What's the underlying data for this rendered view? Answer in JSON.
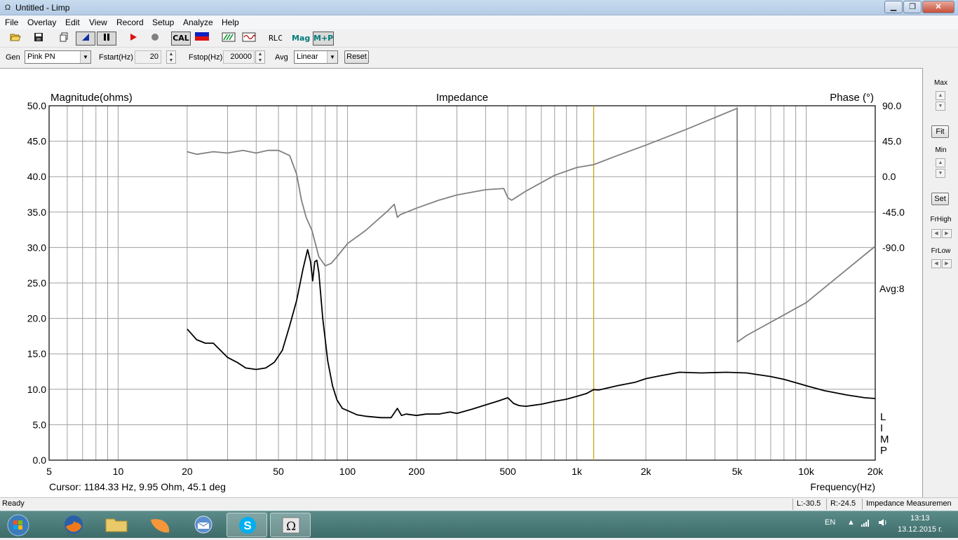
{
  "window": {
    "title": "Untitled - Limp",
    "app_icon": "Ω"
  },
  "menu": [
    "File",
    "Overlay",
    "Edit",
    "View",
    "Record",
    "Setup",
    "Analyze",
    "Help"
  ],
  "toolbar": {
    "cal_label": "CAL",
    "rlc_label": "RLC",
    "mag_label": "Mag",
    "mp_label": "M+P"
  },
  "params": {
    "gen_label": "Gen",
    "gen_value": "Pink PN",
    "fstart_label": "Fstart(Hz)",
    "fstart_value": "20",
    "fstop_label": "Fstop(Hz)",
    "fstop_value": "20000",
    "avg_label": "Avg",
    "avg_value": "Linear",
    "reset_label": "Reset"
  },
  "chart_data": {
    "type": "line",
    "title": "Impedance",
    "ylabel": "Magnitude(ohms)",
    "y2label": "Phase (°)",
    "xlabel": "Frequency(Hz)",
    "xscale": "log",
    "xlim": [
      5,
      20000
    ],
    "ylim": [
      0,
      50
    ],
    "y2lim": [
      -180,
      90
    ],
    "x_ticks": [
      5,
      10,
      20,
      50,
      100,
      200,
      500,
      1000,
      2000,
      5000,
      10000,
      20000
    ],
    "x_tick_labels": [
      "5",
      "10",
      "20",
      "50",
      "100",
      "200",
      "500",
      "1k",
      "2k",
      "5k",
      "10k",
      "20k"
    ],
    "y_tick_labels": [
      "50.0",
      "45.0",
      "40.0",
      "35.0",
      "30.0",
      "25.0",
      "20.0",
      "15.0",
      "10.0",
      "5.0",
      "0.0"
    ],
    "y2_tick_labels": [
      "90.0",
      "45.0",
      "0.0",
      "-45.0",
      "-90.0"
    ],
    "avg_annotation": "Avg:8",
    "side_letters": [
      "L",
      "I",
      "M",
      "P"
    ],
    "cursor_x": 1184.33,
    "cursor_readout": "Cursor: 1184.33 Hz, 9.95 Ohm, 45.1 deg",
    "colors": {
      "magnitude": "#000000",
      "phase": "#808080",
      "cursor": "#c8a000",
      "grid": "#a0a0a0"
    },
    "series": [
      {
        "name": "Magnitude",
        "axis": "left",
        "x": [
          20,
          22,
          24,
          26,
          30,
          33,
          36,
          40,
          44,
          48,
          52,
          56,
          60,
          64,
          67,
          69,
          70.5,
          72,
          73.5,
          75,
          78,
          82,
          86,
          90,
          95,
          100,
          110,
          120,
          140,
          155,
          165,
          172,
          180,
          200,
          220,
          250,
          280,
          300,
          350,
          400,
          450,
          500,
          530,
          560,
          600,
          700,
          800,
          900,
          1000,
          1100,
          1184,
          1250,
          1500,
          1800,
          2000,
          2300,
          2800,
          3500,
          4500,
          5500,
          7000,
          8000,
          10000,
          12000,
          15000,
          18000,
          20000
        ],
        "y": [
          18.5,
          17.0,
          16.5,
          16.5,
          14.5,
          13.8,
          13.0,
          12.8,
          13.0,
          13.8,
          15.5,
          19.0,
          22.5,
          27.0,
          29.7,
          28.0,
          25.3,
          28.0,
          28.2,
          26.5,
          20.0,
          14.0,
          10.5,
          8.5,
          7.3,
          7.0,
          6.4,
          6.2,
          6.0,
          6.0,
          7.3,
          6.3,
          6.5,
          6.3,
          6.5,
          6.5,
          6.8,
          6.6,
          7.2,
          7.8,
          8.3,
          8.8,
          8.0,
          7.7,
          7.6,
          7.9,
          8.3,
          8.6,
          9.0,
          9.4,
          9.95,
          9.9,
          10.5,
          11.0,
          11.5,
          11.9,
          12.4,
          12.3,
          12.4,
          12.3,
          11.8,
          11.4,
          10.5,
          9.8,
          9.2,
          8.8,
          8.7
        ]
      },
      {
        "name": "Phase",
        "axis": "right",
        "x": [
          20,
          22,
          26,
          30,
          35,
          40,
          45,
          50,
          56,
          60,
          63,
          66,
          70,
          75,
          80,
          85,
          90,
          100,
          120,
          150,
          160,
          165,
          170,
          200,
          250,
          300,
          400,
          480,
          500,
          520,
          600,
          800,
          1000,
          1184,
          1500,
          2000,
          3000,
          5000,
          5010,
          5500,
          10000,
          20000
        ],
        "y": [
          55,
          53,
          55,
          54,
          56,
          54,
          56,
          56,
          52,
          38,
          18,
          5,
          -5,
          -25,
          -32,
          -30,
          -25,
          -15,
          -5,
          10,
          15,
          5,
          7,
          12,
          18,
          22,
          26,
          27,
          20,
          18,
          25,
          37,
          43,
          45.1,
          52,
          60,
          72,
          88,
          -90,
          -85,
          -60,
          -17
        ]
      }
    ]
  },
  "right_panel": {
    "max_label": "Max",
    "fit_label": "Fit",
    "min_label": "Min",
    "set_label": "Set",
    "frhigh_label": "FrHigh",
    "frlow_label": "FrLow"
  },
  "status": {
    "ready": "Ready",
    "left_level": "L:-30.5",
    "right_level": "R:-24.5",
    "mode": "Impedance Measuremen"
  },
  "taskbar": {
    "lang": "EN",
    "time": "13:13",
    "date": "13.12.2015 г."
  }
}
